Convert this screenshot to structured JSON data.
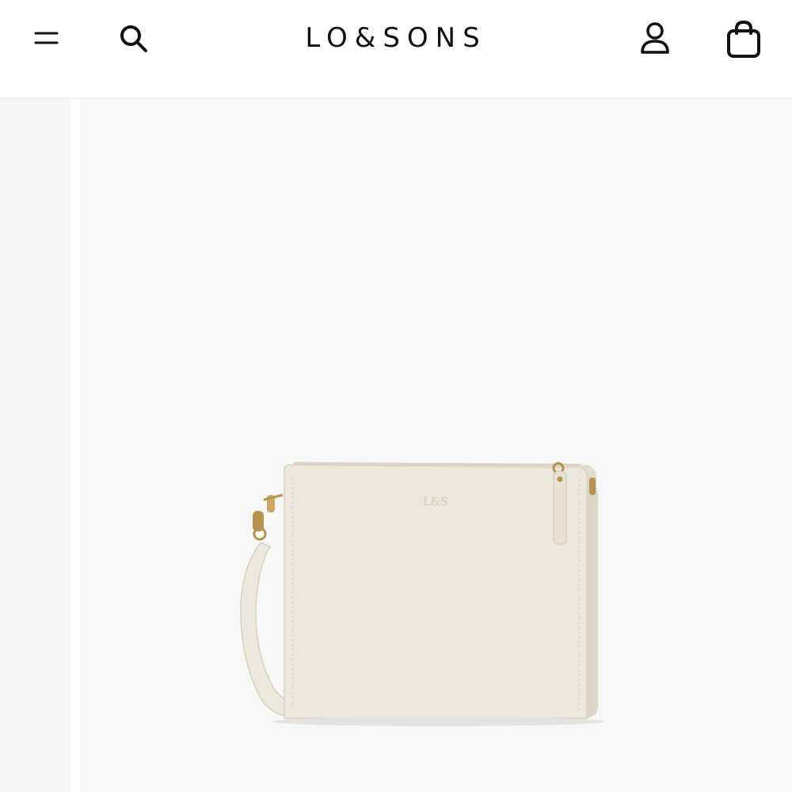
{
  "header": {
    "brand": "LO&SONS",
    "menu_icon": "menu-icon",
    "search_icon": "search-icon",
    "account_icon": "account-icon",
    "bag_icon": "shopping-bag-icon"
  },
  "product": {
    "monogram": "L&S"
  },
  "colors": {
    "header_bg": "#ffffff",
    "text": "#111111",
    "panel_bg": "#f7f7f7",
    "bag_body": "#e9e5d8",
    "hardware_gold": "#b8934f"
  }
}
